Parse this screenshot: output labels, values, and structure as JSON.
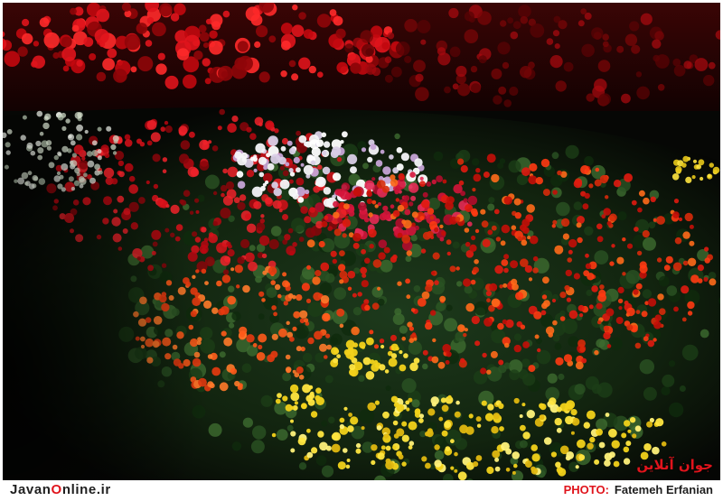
{
  "image": {
    "alt": "Flower beds: red poinsettias in the background, a mass of red, white and pink cyclamen, with orange, red and yellow begonias in the foreground"
  },
  "brand": {
    "prefix": "Javan",
    "highlight": "O",
    "suffix": "nline.ir"
  },
  "watermark": {
    "text": "جوان آنلاین"
  },
  "credit": {
    "label": "PHOTO:",
    "name": "Fatemeh Erfanian"
  },
  "colors": {
    "accent_red": "#e0141c",
    "text_dark": "#1f1f1f"
  }
}
